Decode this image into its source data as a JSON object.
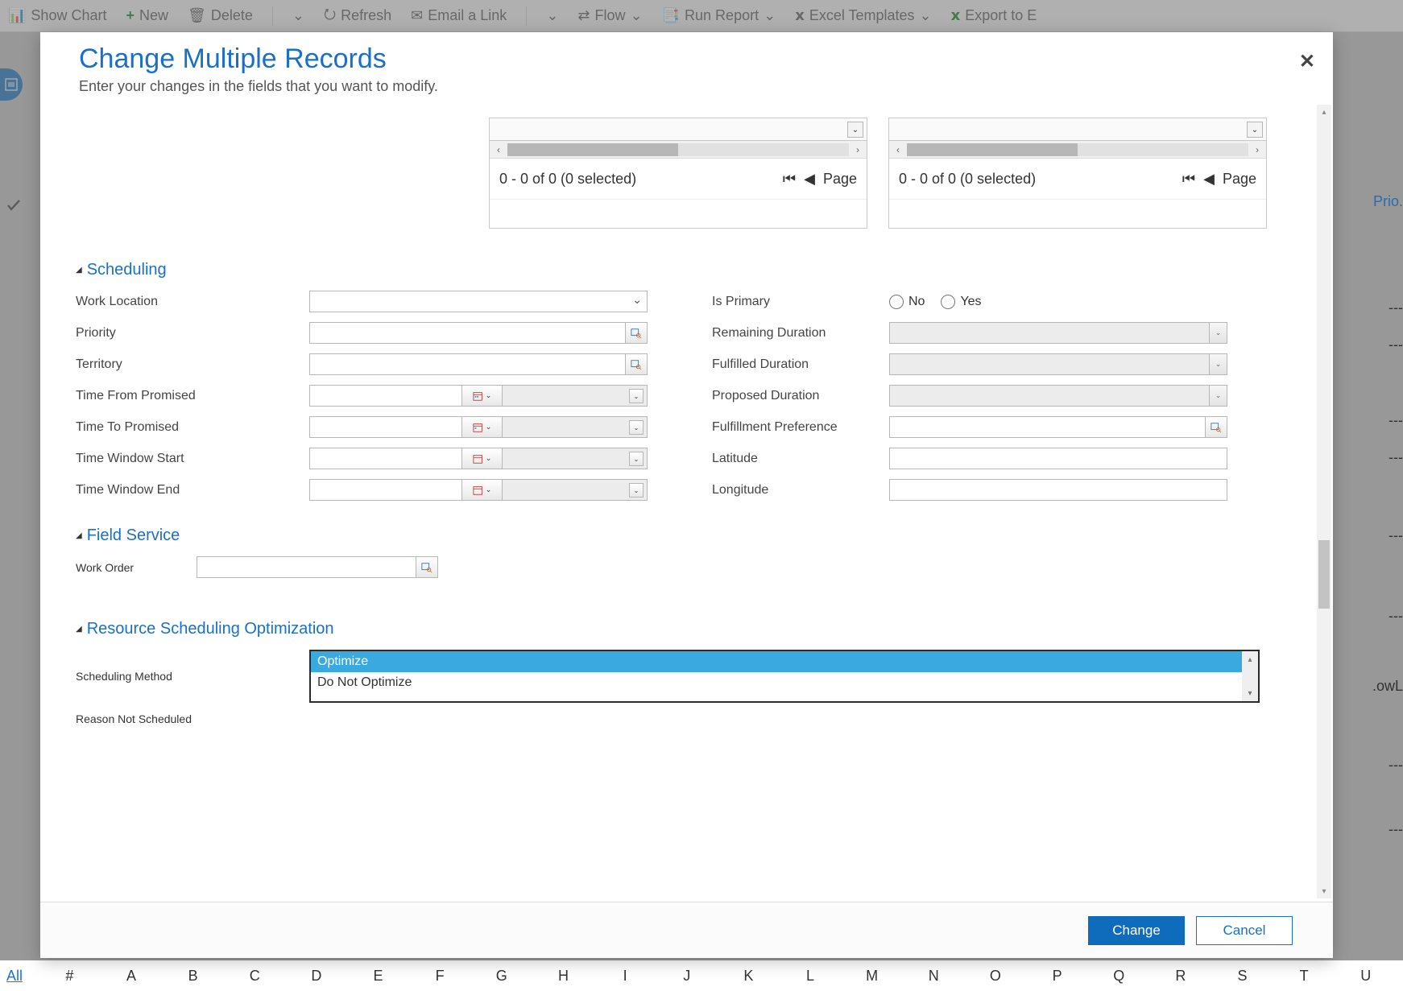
{
  "toolbar": {
    "show_chart": "Show Chart",
    "new": "New",
    "delete": "Delete",
    "refresh": "Refresh",
    "email_link": "Email a Link",
    "flow": "Flow",
    "run_report": "Run Report",
    "excel_templates": "Excel Templates",
    "export": "Export to E"
  },
  "bg": {
    "prio": "Prio.",
    "lowl": ".owL"
  },
  "alpha": {
    "all": "All",
    "letters": [
      "#",
      "A",
      "B",
      "C",
      "D",
      "E",
      "F",
      "G",
      "H",
      "I",
      "J",
      "K",
      "L",
      "M",
      "N",
      "O",
      "P",
      "Q",
      "R",
      "S",
      "T",
      "U"
    ]
  },
  "dialog": {
    "title": "Change Multiple Records",
    "subtitle": "Enter your changes in the fields that you want to modify.",
    "close": "✕"
  },
  "panes": {
    "range": "0 - 0 of 0 (0 selected)",
    "page": "Page"
  },
  "sections": {
    "scheduling": "Scheduling",
    "field_service": "Field Service",
    "rso": "Resource Scheduling Optimization"
  },
  "labels": {
    "work_location": "Work Location",
    "priority": "Priority",
    "territory": "Territory",
    "time_from_promised": "Time From Promised",
    "time_to_promised": "Time To Promised",
    "time_window_start": "Time Window Start",
    "time_window_end": "Time Window End",
    "is_primary": "Is Primary",
    "remaining_duration": "Remaining Duration",
    "fulfilled_duration": "Fulfilled Duration",
    "proposed_duration": "Proposed Duration",
    "fulfillment_preference": "Fulfillment Preference",
    "latitude": "Latitude",
    "longitude": "Longitude",
    "work_order": "Work Order",
    "scheduling_method": "Scheduling Method",
    "reason_not_scheduled": "Reason Not Scheduled"
  },
  "radios": {
    "no": "No",
    "yes": "Yes"
  },
  "rso_options": {
    "optimize": "Optimize",
    "do_not_optimize": "Do Not Optimize"
  },
  "buttons": {
    "change": "Change",
    "cancel": "Cancel"
  }
}
